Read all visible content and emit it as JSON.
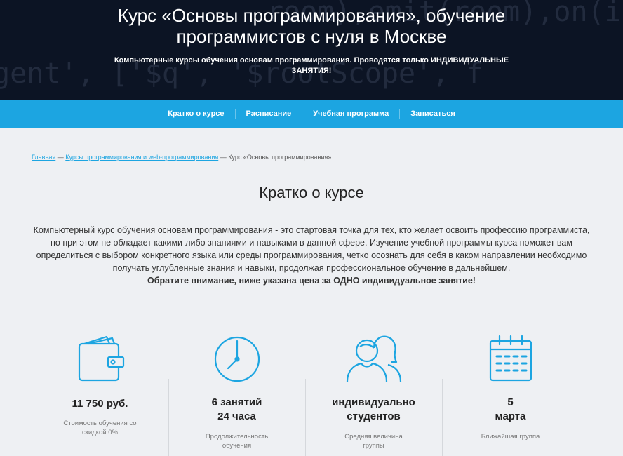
{
  "hero": {
    "title": "Курс «Основы программирования», обучение программистов с нуля в Москве",
    "subtitle": "Компьютерные курсы обучения основам программирования. Проводятся только ИНДИВИДУАЛЬНЫЕ ЗАНЯТИЯ!",
    "bg_code": [
      "room),emit(room),on(io, room",
      "gent', ['$q', '$rootScope', f"
    ]
  },
  "nav": {
    "items": [
      "Кратко о курсе",
      "Расписание",
      "Учебная программа",
      "Записаться"
    ]
  },
  "breadcrumb": {
    "home": "Главная",
    "separator1": " — ",
    "category": "Курсы программирования и web-программирования",
    "separator2": " — ",
    "current": "Курс «Основы программирования»"
  },
  "section": {
    "title": "Кратко о курсе",
    "description": "Компьютерный курс обучения основам программирования - это стартовая точка для тех, кто желает освоить профессию программиста, но при этом не обладает какими-либо знаниями и навыками в данной сфере. Изучение учебной программы курса поможет вам определиться с выбором конкретного языка или среды программирования, четко осознать для себя в каком направлении необходимо получать углубленные знания и навыки, продолжая профессиональное обучение в дальнейшем.",
    "note": "Обратите внимание, ниже указана цена за ОДНО индивидуальное занятие!"
  },
  "features": [
    {
      "icon": "wallet-icon",
      "value_lines": [
        "11 750 руб."
      ],
      "label_lines": [
        "Стоимость обучения со",
        "скидкой 0%"
      ]
    },
    {
      "icon": "clock-icon",
      "value_lines": [
        "6 занятий",
        "24 часа"
      ],
      "label_lines": [
        "Продолжительность",
        "обучения"
      ]
    },
    {
      "icon": "people-icon",
      "value_lines": [
        "индивидуально",
        "студентов"
      ],
      "label_lines": [
        "Средняя величина",
        "группы"
      ]
    },
    {
      "icon": "calendar-icon",
      "value_lines": [
        "5",
        "марта"
      ],
      "label_lines": [
        "Ближайшая группа"
      ]
    }
  ],
  "colors": {
    "accent": "#1ca5e1",
    "hero_bg": "#0c1424",
    "page_bg": "#eef0f3"
  }
}
